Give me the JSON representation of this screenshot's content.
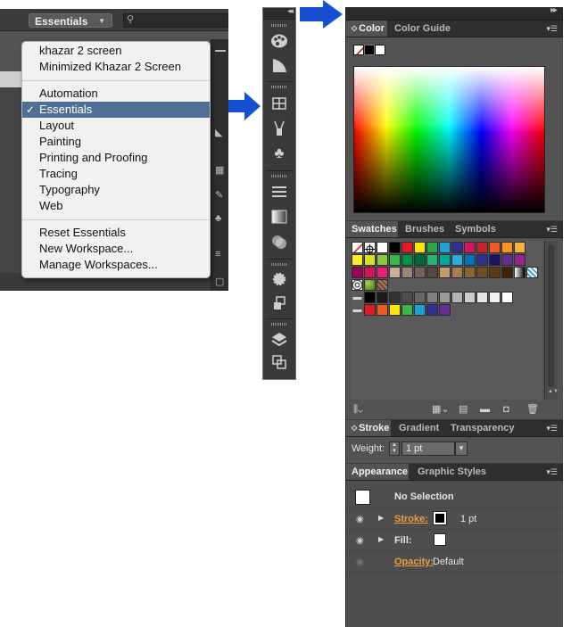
{
  "left_screenshot": {
    "workspace_switcher": {
      "label": "Essentials"
    },
    "menu": {
      "group1": [
        "khazar 2 screen",
        "Minimized Khazar 2 Screen"
      ],
      "group2": [
        "Automation",
        "Essentials",
        "Layout",
        "Painting",
        "Printing and Proofing",
        "Tracing",
        "Typography",
        "Web"
      ],
      "selected": "Essentials",
      "checkmark": "✓",
      "group3": [
        "Reset Essentials",
        "New Workspace...",
        "Manage Workspaces..."
      ]
    }
  },
  "arrow_color": "#1450d2",
  "middle_toolbar": {
    "icons": [
      "color-palette-icon",
      "color-guide-icon",
      "swatches-icon",
      "brushes-icon",
      "symbols-icon",
      "stroke-icon",
      "gradient-icon",
      "transparency-icon",
      "appearance-icon",
      "graphic-styles-icon",
      "layers-icon",
      "artboards-icon"
    ]
  },
  "dock": {
    "color_panel": {
      "tabs": [
        "Color",
        "Color Guide"
      ],
      "active_tab": "Color"
    },
    "swatches_panel": {
      "tabs": [
        "Swatches",
        "Brushes",
        "Symbols"
      ],
      "active_tab": "Swatches",
      "row1_colors": [
        "#ffffff",
        "#000000",
        "#e01b24",
        "#ffe600",
        "#28a745",
        "#1ea1d2",
        "#2e3192",
        "#d4145a",
        "#c1272d",
        "#f15a24",
        "#f7931e",
        "#fbb03b"
      ],
      "row2_colors": [
        "#fcee21",
        "#d9e021",
        "#8cc63f",
        "#39b54a",
        "#009245",
        "#006837",
        "#22b573",
        "#00a99d",
        "#29abe2",
        "#0071bc",
        "#2e3192",
        "#1b1464",
        "#662d91",
        "#93278f"
      ],
      "row3_colors": [
        "#9e005d",
        "#d4145a",
        "#ed1e79",
        "#c7b299",
        "#998675",
        "#736357",
        "#534741",
        "#c69c6d",
        "#a67c52",
        "#8c6239",
        "#754c24",
        "#603813",
        "#42210b"
      ],
      "gray_colors": [
        "#000000",
        "#1a1a1a",
        "#333333",
        "#4d4d4d",
        "#666666",
        "#808080",
        "#999999",
        "#b3b3b3",
        "#cccccc",
        "#e6e6e6",
        "#f2f2f2",
        "#ffffff"
      ],
      "bright_colors": [
        "#e01b24",
        "#f15a24",
        "#ffe600",
        "#39b54a",
        "#1ea1d2",
        "#2e3192",
        "#662d91"
      ]
    },
    "stroke_panel": {
      "tabs": [
        "Stroke",
        "Gradient",
        "Transparency"
      ],
      "active_tab": "Stroke",
      "weight_label": "Weight:",
      "weight_value": "1 pt"
    },
    "appearance_panel": {
      "tabs": [
        "Appearance",
        "Graphic Styles"
      ],
      "active_tab": "Appearance",
      "selection_label": "No Selection",
      "stroke_label": "Stroke:",
      "stroke_value": "1 pt",
      "fill_label": "Fill:",
      "opacity_label": "Opacity:",
      "opacity_value": "Default"
    }
  }
}
